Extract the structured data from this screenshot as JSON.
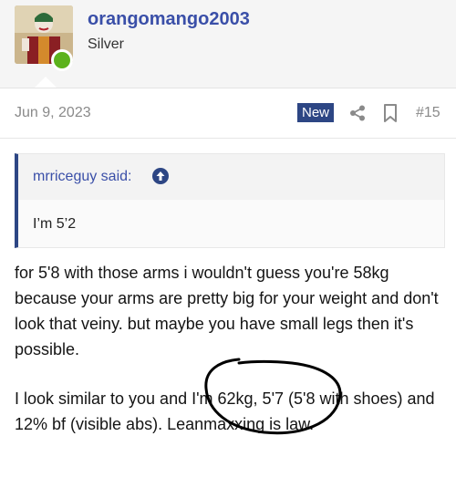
{
  "user": {
    "name": "orangomango2003",
    "title": "Silver",
    "online_color": "#5cb21c",
    "avatar_icon": "joker-avatar"
  },
  "post": {
    "date": "Jun 9, 2023",
    "new_badge": "New",
    "number": "#15",
    "quote": {
      "author": "mrriceguy said:",
      "text": "I’m 5’2"
    },
    "paragraphs": [
      "for 5'8 with those arms i wouldn't guess you're 58kg because your arms are pretty big for your weight and don't look that veiny. but maybe you have small legs then it's possible.",
      "I look similar to you and I'm 62kg, 5'7 (5'8 with shoes) and 12% bf (visible abs). Leanmaxxing is law."
    ]
  },
  "colors": {
    "accent": "#2d4684",
    "link": "#3a4fa8"
  }
}
